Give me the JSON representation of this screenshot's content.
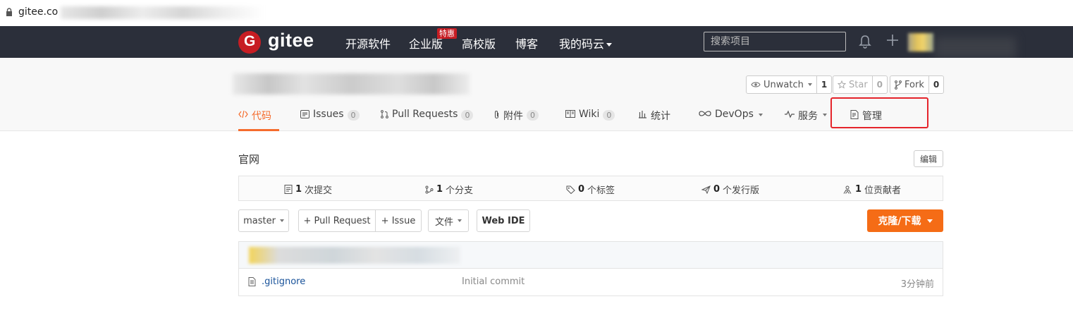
{
  "browser": {
    "url": "gitee.co"
  },
  "nav": {
    "logo": "gitee",
    "items": [
      {
        "label": "开源软件"
      },
      {
        "label": "企业版",
        "badge": "特惠"
      },
      {
        "label": "高校版"
      },
      {
        "label": "博客"
      },
      {
        "label": "我的码云"
      }
    ],
    "search_placeholder": "搜索项目"
  },
  "repo": {
    "watch": {
      "label": "Unwatch",
      "count": "1"
    },
    "star": {
      "label": "Star",
      "count": "0"
    },
    "fork": {
      "label": "Fork",
      "count": "0"
    },
    "tabs": [
      {
        "label": "代码",
        "active": true
      },
      {
        "label": "Issues",
        "count": "0"
      },
      {
        "label": "Pull Requests",
        "count": "0"
      },
      {
        "label": "附件",
        "count": "0"
      },
      {
        "label": "Wiki",
        "count": "0"
      },
      {
        "label": "统计"
      },
      {
        "label": "DevOps"
      },
      {
        "label": "服务"
      },
      {
        "label": "管理"
      }
    ]
  },
  "main": {
    "description": "官网",
    "edit_label": "编辑",
    "stats": [
      {
        "count": "1",
        "label": "次提交"
      },
      {
        "count": "1",
        "label": "个分支"
      },
      {
        "count": "0",
        "label": "个标签"
      },
      {
        "count": "0",
        "label": "个发行版"
      },
      {
        "count": "1",
        "label": "位贡献者"
      }
    ],
    "toolbar": {
      "branch": "master",
      "pull_request": "+ Pull Request",
      "issue": "+ Issue",
      "file": "文件",
      "web_ide": "Web IDE",
      "clone": "克隆/下载"
    },
    "files": [
      {
        "name": ".gitignore",
        "commit": "Initial commit",
        "time": "3分钟前"
      }
    ]
  },
  "colors": {
    "accent": "#f56c16",
    "nav_bg": "#2b2f3a",
    "logo_red": "#c71d23",
    "highlight": "#e5242b"
  }
}
